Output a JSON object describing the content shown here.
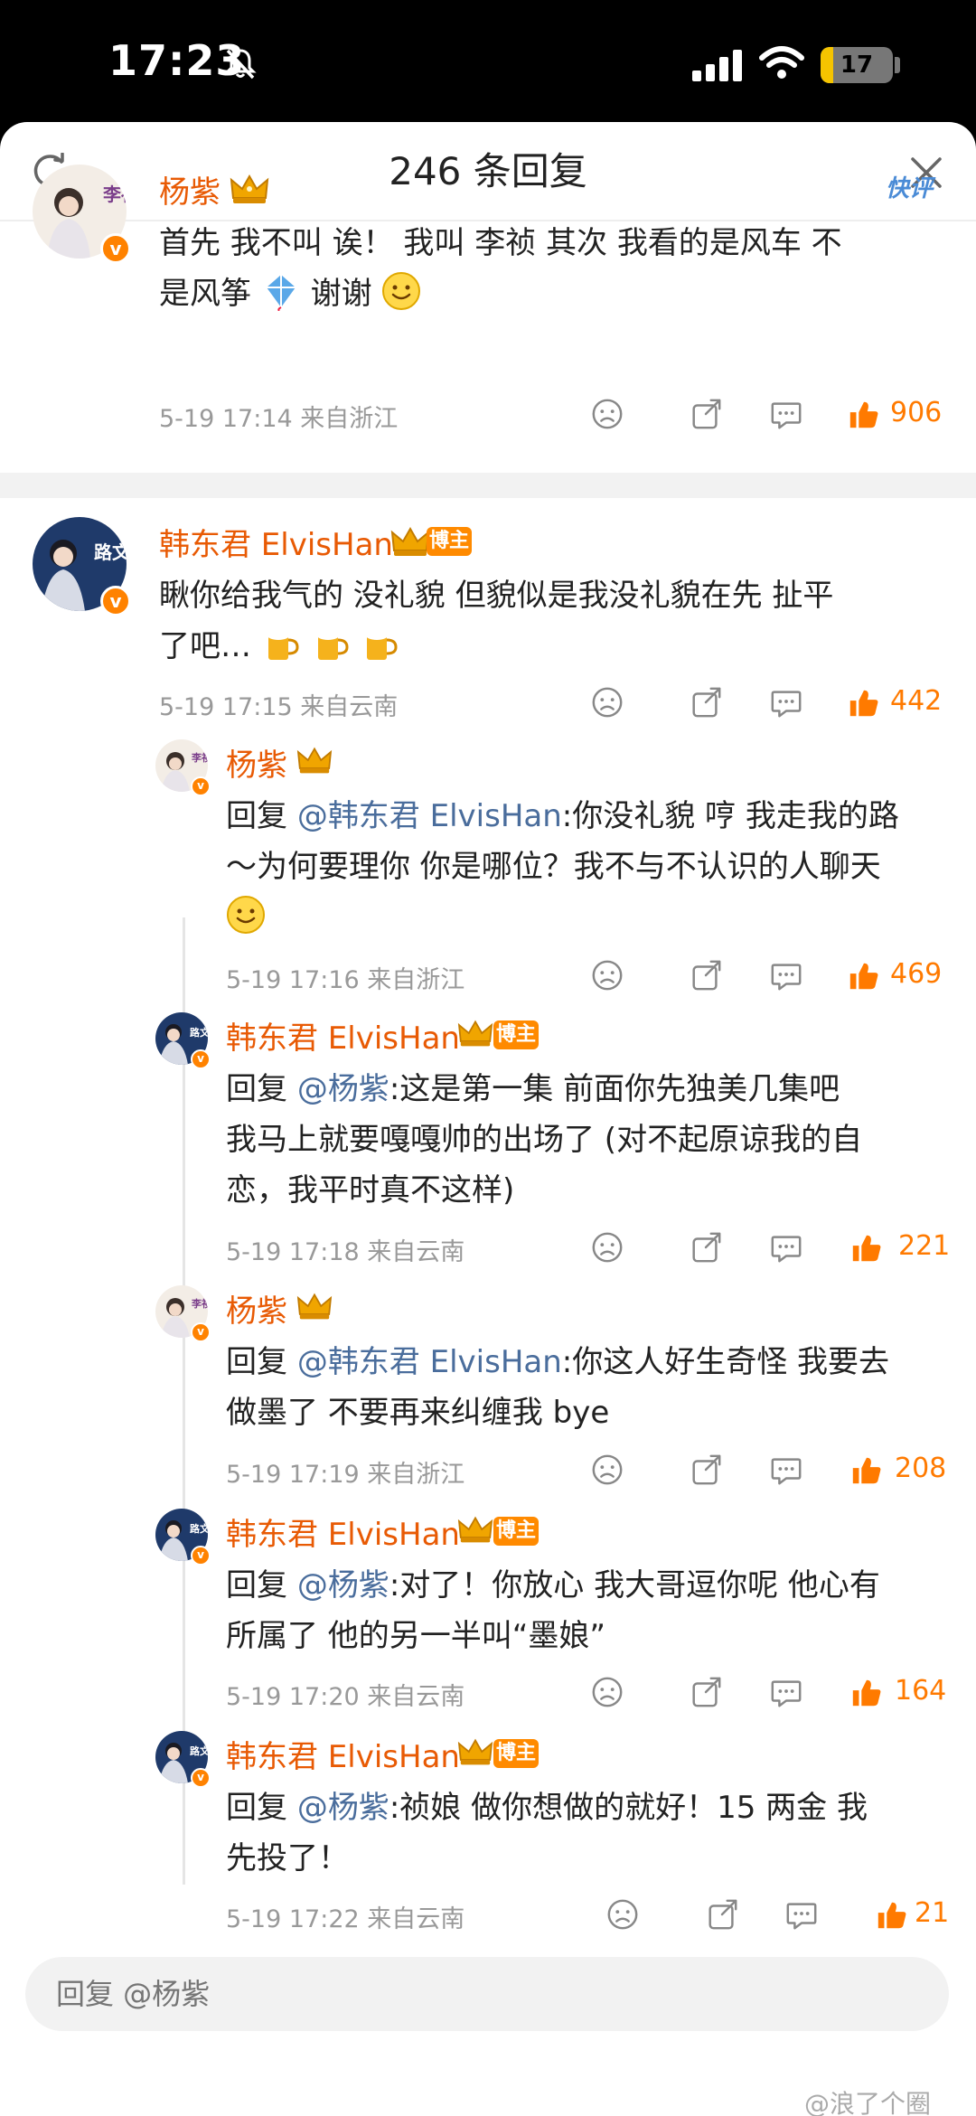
{
  "status_bar": {
    "time": "17:23",
    "battery": "17",
    "battery_level": 0.17
  },
  "header": {
    "title": "246 条回复"
  },
  "root_comment": {
    "username": "杨紫",
    "quick_label": "快评",
    "text_1": "首先 我不叫 诶！ 我叫 李祯 其次 我看的是风车 不",
    "text_2a": "是风筝",
    "text_2b": "谢谢",
    "time": "5-19 17:14",
    "source": "来自浙江",
    "likes": "906"
  },
  "comment2": {
    "username": "韩东君 ElvisHan",
    "badge": "博主",
    "text_1": "瞅你给我气的  没礼貌   但貌似是我没礼貌在先   扯平",
    "text_2": "了吧…",
    "time": "5-19 17:15",
    "source": "来自云南",
    "likes": "442"
  },
  "replies": [
    {
      "username": "杨紫",
      "reply_prefix": "回复 ",
      "mention": "@韩东君 ElvisHan",
      "line_1": ":你没礼貌 哼 我走我的路",
      "line_2": "～为何要理你 你是哪位？我不与不认识的人聊天",
      "time": "5-19 17:16",
      "source": "来自浙江",
      "likes": "469"
    },
    {
      "username": "韩东君 ElvisHan",
      "badge": "博主",
      "reply_prefix": "回复 ",
      "mention": "@杨紫",
      "line_1": ":这是第一集  前面你先独美几集吧",
      "line_2": "我马上就要嘎嘎帅的出场了 (对不起原谅我的自",
      "line_3": "恋，我平时真不这样)",
      "time": "5-19 17:18",
      "source": "来自云南",
      "likes": "221"
    },
    {
      "username": "杨紫",
      "reply_prefix": "回复 ",
      "mention": "@韩东君 ElvisHan",
      "line_1": ":你这人好生奇怪 我要去",
      "line_2": "做墨了 不要再来纠缠我 bye",
      "time": "5-19 17:19",
      "source": "来自浙江",
      "likes": "208"
    },
    {
      "username": "韩东君 ElvisHan",
      "badge": "博主",
      "reply_prefix": "回复 ",
      "mention": "@杨紫",
      "line_1": ":对了！你放心 我大哥逗你呢  他心有",
      "line_2": "所属了  他的另一半叫“墨娘”",
      "time": "5-19 17:20",
      "source": "来自云南",
      "likes": "164"
    },
    {
      "username": "韩东君 ElvisHan",
      "badge": "博主",
      "reply_prefix": "回复 ",
      "mention": "@杨紫",
      "line_1": ":祯娘  做你想做的就好！15 两金 我",
      "line_2": "先投了！",
      "time": "5-19 17:22",
      "source": "来自云南",
      "likes": "21"
    }
  ],
  "footer": {
    "placeholder": "回复 @杨紫"
  },
  "watermark": "@浪了个圈",
  "avatar_labels": {
    "yangzi": "李祯",
    "han": "路文"
  },
  "icons": [
    "refresh-icon",
    "close-icon",
    "dislike-icon",
    "share-icon",
    "comment-icon",
    "like-icon",
    "crown-icon",
    "smile-emoji",
    "beer-emoji",
    "kite-emoji"
  ],
  "colors": {
    "accent": "#ff7a00",
    "username": "#e85a04",
    "mention": "#4a6d9c",
    "verified": "#ff8200"
  }
}
